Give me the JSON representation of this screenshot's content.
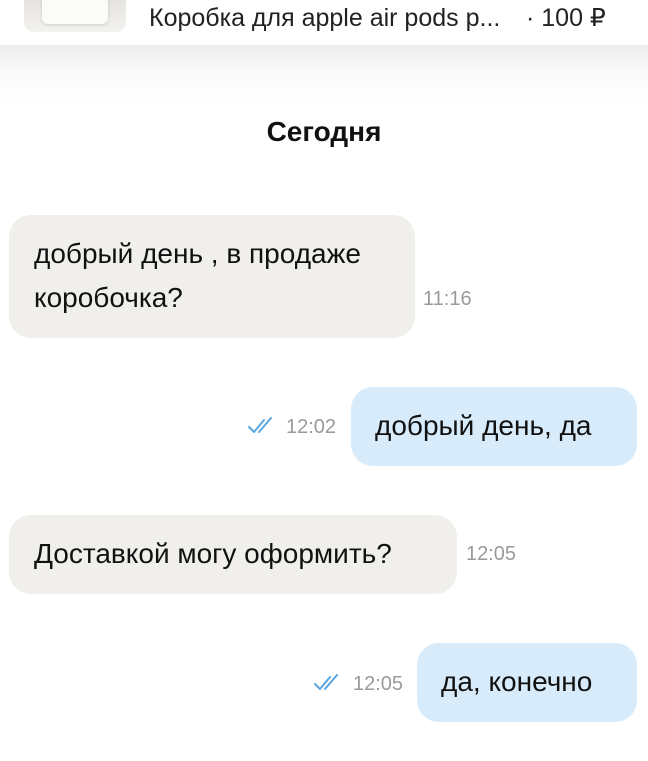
{
  "product": {
    "title": "Коробка для apple air pods р...",
    "price": "· 100 ₽"
  },
  "date_divider": "Сегодня",
  "messages": [
    {
      "direction": "incoming",
      "text": "добрый день , в продаже\nкоробочка?",
      "time": "11:16"
    },
    {
      "direction": "outgoing",
      "text": "добрый день, да",
      "time": "12:02",
      "status_icon": "double-check-icon"
    },
    {
      "direction": "incoming",
      "text": "Доставкой могу оформить?",
      "time": "12:05"
    },
    {
      "direction": "outgoing",
      "text": "да, конечно",
      "time": "12:05",
      "status_icon": "double-check-icon"
    }
  ],
  "colors": {
    "incoming_bubble": "#f1efeb",
    "outgoing_bubble": "#d7ebfa",
    "read_check": "#5aa7e0",
    "timestamp": "#9a9a9a"
  }
}
